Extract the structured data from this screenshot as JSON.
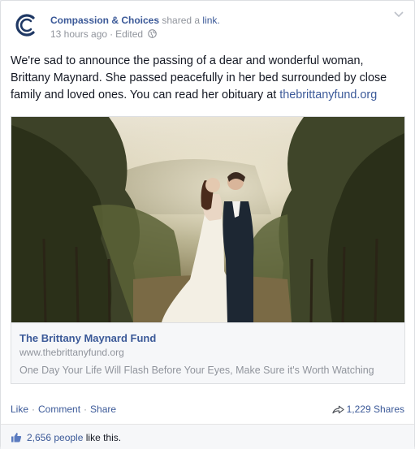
{
  "post": {
    "page_name": "Compassion & Choices",
    "shared_text": " shared a ",
    "shared_link_word": "link.",
    "timestamp": "13 hours ago",
    "edited": "Edited",
    "message_text": "We're sad to announce the passing of a dear and wonderful woman, Brittany Maynard. She passed peacefully in her bed surrounded by close family and loved ones. You can read her obituary at ",
    "message_link": "thebrittanyfund.org"
  },
  "attachment": {
    "title": "The Brittany Maynard Fund",
    "domain": "www.thebrittanyfund.org",
    "description": "One Day Your Life Will Flash Before Your Eyes, Make Sure it's Worth Watching"
  },
  "actions": {
    "like": "Like",
    "comment": "Comment",
    "share": "Share",
    "shares_count": "1,229 Shares"
  },
  "likes": {
    "people": "2,656 people",
    "suffix": " like this."
  },
  "icons": {
    "avatar": "compassion-choices-logo",
    "privacy": "globe-icon",
    "menu": "chevron-down-icon",
    "shares": "share-arrow-icon",
    "likes": "thumbs-up-icon"
  },
  "colors": {
    "link": "#3b5998",
    "muted": "#90949c",
    "text": "#141823"
  }
}
